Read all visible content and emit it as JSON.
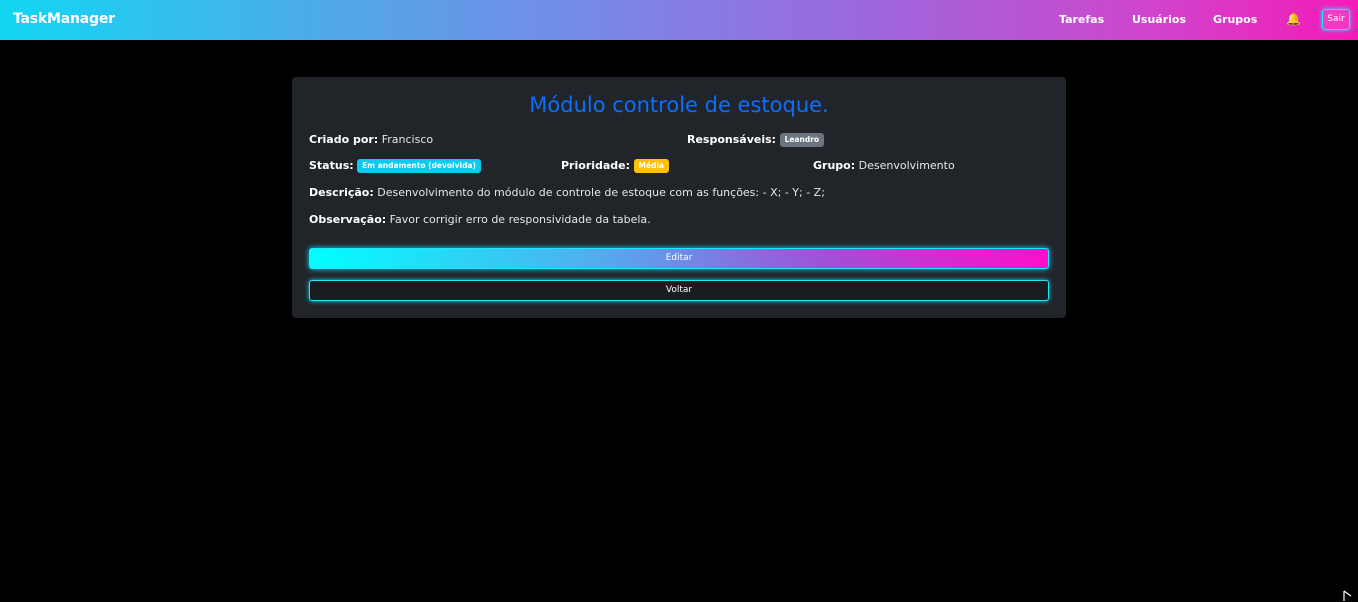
{
  "navbar": {
    "brand": "TaskManager",
    "links": [
      "Tarefas",
      "Usuários",
      "Grupos"
    ],
    "notification_icon": "bell-icon",
    "logout_label": "Sair"
  },
  "task": {
    "title": "Módulo controle de estoque.",
    "created_by_label": "Criado por:",
    "created_by": "Francisco",
    "assignees_label": "Responsáveis:",
    "assignees": [
      "Leandro"
    ],
    "status_label": "Status:",
    "status": "Em andamento (devolvida)",
    "priority_label": "Prioridade:",
    "priority": "Média",
    "group_label": "Grupo:",
    "group": "Desenvolvimento",
    "description_label": "Descrição:",
    "description": "Desenvolvimento do módulo de controle de estoque com as funções: - X; - Y; - Z;",
    "observation_label": "Observação:",
    "observation": "Favor corrigir erro de responsividade da tabela."
  },
  "actions": {
    "edit_label": "Editar",
    "back_label": "Voltar"
  },
  "colors": {
    "title": "#0d6efd",
    "status_badge": "#0dcaf0",
    "priority_badge": "#ffc107",
    "assignee_badge": "#6c757d",
    "card_bg": "#212529",
    "neon_border": "#1ee6ff"
  }
}
